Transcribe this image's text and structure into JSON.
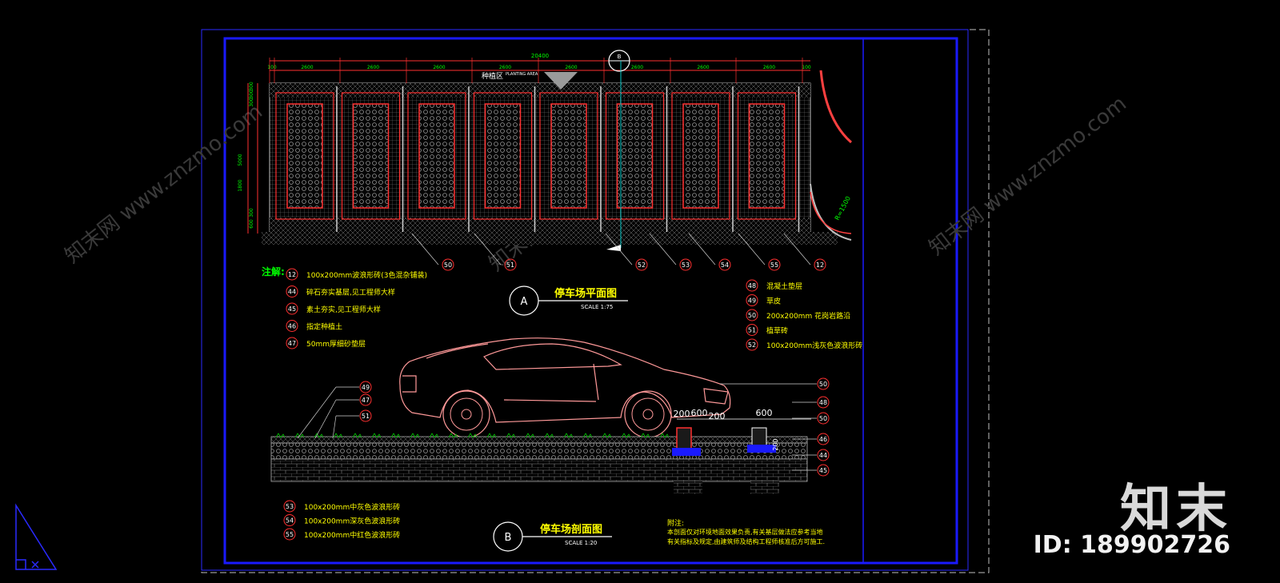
{
  "drawing": {
    "plan": {
      "total_dim": "20400",
      "segment_dims": [
        "100",
        "2600",
        "2600",
        "2600",
        "2600",
        "2600",
        "2600",
        "2600",
        "2600",
        "100"
      ],
      "left_dims": [
        "300",
        "300",
        "300",
        "5000",
        "1800",
        "300",
        "600"
      ],
      "planting_label": "种植区",
      "planting_en": "PLANTING AREA",
      "north_mark": "B",
      "radius_label": "R=1500",
      "callouts": [
        "50",
        "51",
        "52",
        "53",
        "54",
        "55",
        "12"
      ]
    },
    "notes_title": "注解:",
    "notes_left": [
      {
        "n": "12",
        "text": "100x200mm波浪形砖(3色混杂铺装)"
      },
      {
        "n": "44",
        "text": "碎石夯实基层,见工程师大样"
      },
      {
        "n": "45",
        "text": "素土夯实,见工程师大样"
      },
      {
        "n": "46",
        "text": "指定种植土"
      },
      {
        "n": "47",
        "text": "50mm厚细砂垫层"
      }
    ],
    "notes_right": [
      {
        "n": "48",
        "text": "混凝土垫层"
      },
      {
        "n": "49",
        "text": "草皮"
      },
      {
        "n": "50",
        "text": "200x200mm 花岗岩路沿"
      },
      {
        "n": "51",
        "text": "植草砖"
      },
      {
        "n": "52",
        "text": "100x200mm浅灰色波浪形砖"
      }
    ],
    "title_a": {
      "letter": "A",
      "title": "停车场平面图",
      "scale": "SCALE  1:75"
    },
    "section": {
      "left_callouts": [
        "49",
        "47",
        "51"
      ],
      "right_callouts": [
        "50",
        "48",
        "50",
        "46",
        "44",
        "45"
      ],
      "dims": [
        "200",
        "600",
        "200",
        "600",
        "200"
      ]
    },
    "notes_bottom": [
      {
        "n": "53",
        "text": "100x200mm中灰色波浪形砖"
      },
      {
        "n": "54",
        "text": "100x200mm深灰色波浪形砖"
      },
      {
        "n": "55",
        "text": "100x200mm中红色波浪形砖"
      }
    ],
    "title_b": {
      "letter": "B",
      "title": "停车场剖面图",
      "scale": "SCALE  1:20"
    },
    "remark": {
      "title": "附注:",
      "line1": "本剖面仅对环境地面效果负责,有关基层做法应参考当地",
      "line2": "有关指标及规定,由建筑师及结构工程师核准后方可施工."
    }
  },
  "watermark": {
    "url": "www.znzmo.com",
    "cn": "知末网",
    "brand": "知末",
    "id_text": "ID: 189902726"
  },
  "colors": {
    "frame_blue": "#1a1aff",
    "dim_red": "#ff3030",
    "text_yellow": "#ffff00",
    "text_green": "#00ff00",
    "hatch_gray": "#a0a0a0",
    "car_pink": "#ff9999"
  }
}
